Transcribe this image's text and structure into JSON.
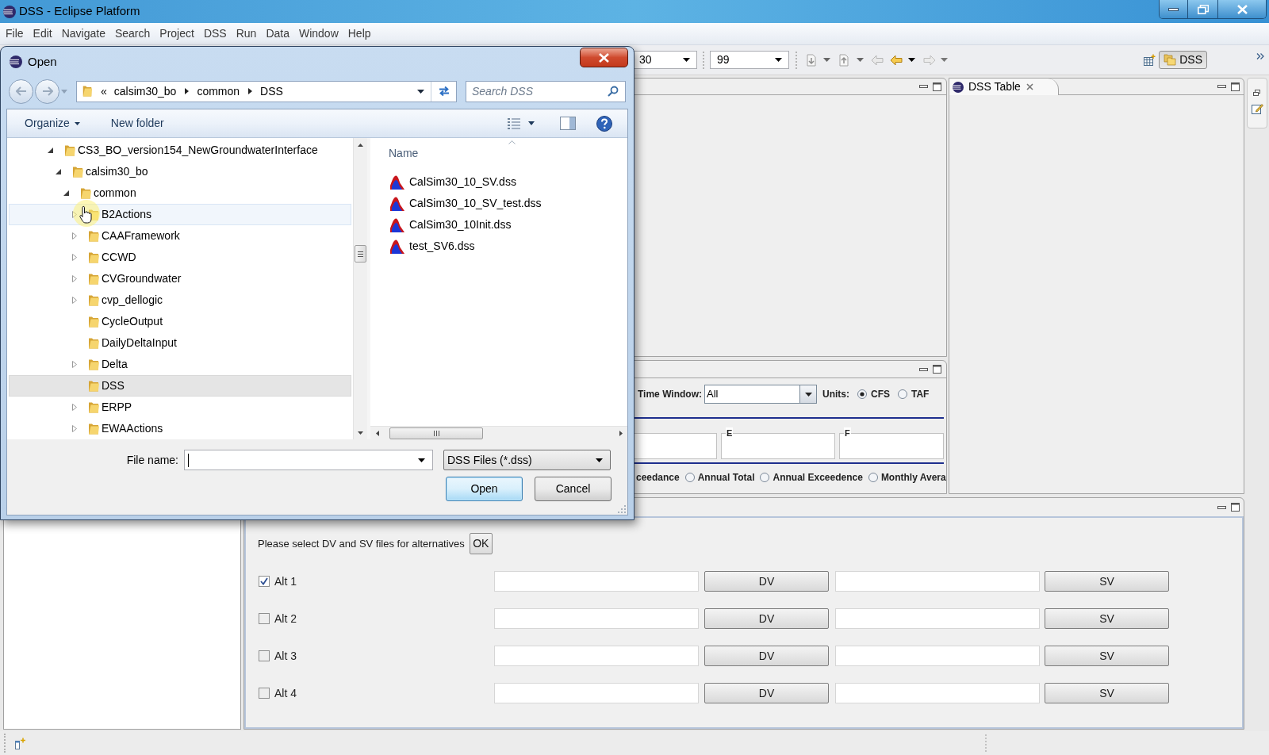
{
  "window": {
    "title": "DSS - Eclipse Platform"
  },
  "menu": [
    "File",
    "Edit",
    "Navigate",
    "Search",
    "Project",
    "DSS",
    "Run",
    "Data",
    "Window",
    "Help"
  ],
  "toolbar": {
    "combos": [
      {
        "value": "30"
      },
      {
        "value": "99"
      }
    ],
    "perspective": {
      "label": "DSS",
      "selected": true
    }
  },
  "dss_table_view": {
    "tab": "DSS Table"
  },
  "chart_options_view": {
    "time_window": {
      "label": "Time Window:",
      "value": "All"
    },
    "units": {
      "label": "Units:",
      "options": [
        {
          "label": "CFS",
          "selected": true
        },
        {
          "label": "TAF",
          "selected": false
        }
      ]
    },
    "field_boxes": [
      {
        "kind": "plain"
      },
      {
        "kind": "titled",
        "label": "E"
      },
      {
        "kind": "titled",
        "label": "F"
      }
    ],
    "chart_types": [
      {
        "kind": "cut_label",
        "label": "ceedance"
      },
      {
        "kind": "radio",
        "label": "Annual Total",
        "selected": false
      },
      {
        "kind": "radio",
        "label": "Annual Exceedence",
        "selected": false
      },
      {
        "kind": "radio",
        "label": "Monthly Avera",
        "selected": false
      }
    ]
  },
  "alternatives_view": {
    "prompt": "Please select DV and SV files for alternatives",
    "ok_button": "OK",
    "rows": [
      {
        "label": "Alt 1",
        "checked": true,
        "dv_button": "DV",
        "sv_button": "SV"
      },
      {
        "label": "Alt 2",
        "checked": false,
        "dv_button": "DV",
        "sv_button": "SV"
      },
      {
        "label": "Alt 3",
        "checked": false,
        "dv_button": "DV",
        "sv_button": "SV"
      },
      {
        "label": "Alt 4",
        "checked": false,
        "dv_button": "DV",
        "sv_button": "SV"
      }
    ]
  },
  "open_dialog": {
    "title": "Open",
    "address": {
      "overflow": "«",
      "crumbs": [
        "calsim30_bo",
        "common",
        "DSS"
      ]
    },
    "search": {
      "placeholder": "Search DSS"
    },
    "commands": [
      {
        "label": "Organize",
        "menu": true
      },
      {
        "label": "New folder",
        "menu": false
      }
    ],
    "tree": [
      {
        "label": "CS3_BO_version154_NewGroundwaterInterface",
        "kind": "branch",
        "expanded": true,
        "selected": false,
        "hovered": false,
        "children": [
          {
            "label": "calsim30_bo",
            "kind": "branch",
            "expanded": true,
            "selected": false,
            "hovered": false,
            "children": [
              {
                "label": "common",
                "kind": "branch",
                "expanded": true,
                "selected": false,
                "hovered": false,
                "children": [
                  {
                    "label": "B2Actions",
                    "kind": "branch",
                    "expanded": false,
                    "selected": false,
                    "hovered": true
                  },
                  {
                    "label": "CAAFramework",
                    "kind": "branch",
                    "expanded": false,
                    "selected": false,
                    "hovered": false
                  },
                  {
                    "label": "CCWD",
                    "kind": "branch",
                    "expanded": false,
                    "selected": false,
                    "hovered": false
                  },
                  {
                    "label": "CVGroundwater",
                    "kind": "branch",
                    "expanded": false,
                    "selected": false,
                    "hovered": false
                  },
                  {
                    "label": "cvp_dellogic",
                    "kind": "branch",
                    "expanded": false,
                    "selected": false,
                    "hovered": false
                  },
                  {
                    "label": "CycleOutput",
                    "kind": "leaf",
                    "selected": false,
                    "hovered": false
                  },
                  {
                    "label": "DailyDeltaInput",
                    "kind": "leaf",
                    "selected": false,
                    "hovered": false
                  },
                  {
                    "label": "Delta",
                    "kind": "branch",
                    "expanded": false,
                    "selected": false,
                    "hovered": false
                  },
                  {
                    "label": "DSS",
                    "kind": "leaf",
                    "selected": true,
                    "hovered": false
                  },
                  {
                    "label": "ERPP",
                    "kind": "branch",
                    "expanded": false,
                    "selected": false,
                    "hovered": false
                  },
                  {
                    "label": "EWAActions",
                    "kind": "branch",
                    "expanded": false,
                    "selected": false,
                    "hovered": false
                  }
                ]
              }
            ]
          }
        ]
      }
    ],
    "files": {
      "column": {
        "label": "Name",
        "sort_ascending": true
      },
      "items": [
        {
          "name": "CalSim30_10_SV.dss"
        },
        {
          "name": "CalSim30_10_SV_test.dss"
        },
        {
          "name": "CalSim30_10Init.dss"
        },
        {
          "name": "test_SV6.dss"
        }
      ]
    },
    "file_name": {
      "label": "File name:"
    },
    "filter": {
      "value": "DSS Files (*.dss)"
    },
    "buttons": [
      {
        "label": "Open",
        "default": true
      },
      {
        "label": "Cancel",
        "default": false
      }
    ]
  }
}
